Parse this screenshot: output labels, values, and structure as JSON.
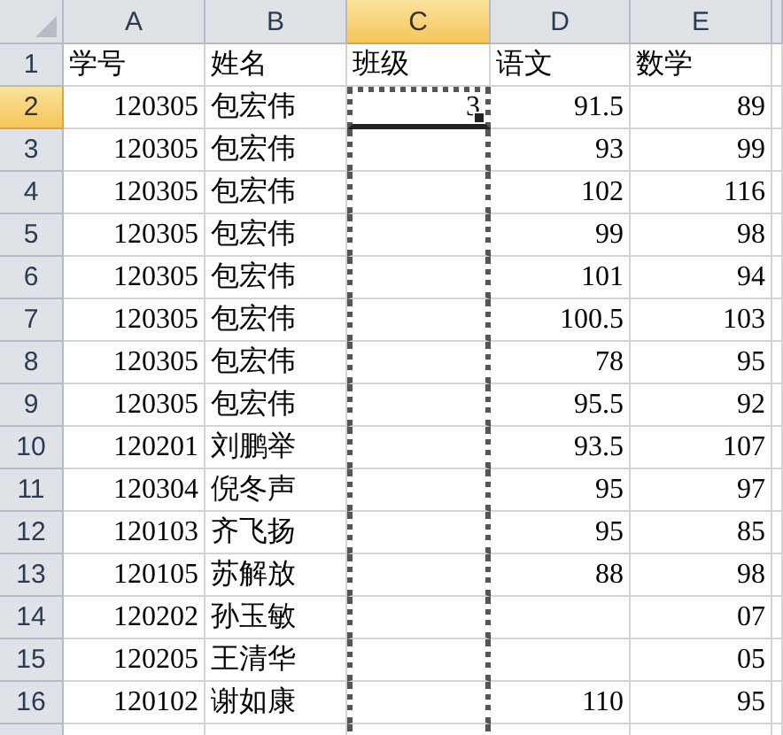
{
  "columns": [
    {
      "label": "A",
      "selected": false,
      "marquee": false
    },
    {
      "label": "B",
      "selected": false,
      "marquee": false
    },
    {
      "label": "C",
      "selected": true,
      "marquee": true
    },
    {
      "label": "D",
      "selected": false,
      "marquee": false
    },
    {
      "label": "E",
      "selected": false,
      "marquee": false
    }
  ],
  "rows": [
    {
      "number": "1",
      "selected": false,
      "kind": "header",
      "cells": [
        "学号",
        "姓名",
        "班级",
        "语文",
        "数学"
      ]
    },
    {
      "number": "2",
      "selected": true,
      "kind": "data",
      "cells": [
        "120305",
        "包宏伟",
        "3",
        "91.5",
        "89"
      ]
    },
    {
      "number": "3",
      "selected": false,
      "kind": "data",
      "cells": [
        "120305",
        "包宏伟",
        null,
        "93",
        "99"
      ]
    },
    {
      "number": "4",
      "selected": false,
      "kind": "data",
      "cells": [
        "120305",
        "包宏伟",
        null,
        "102",
        "116"
      ]
    },
    {
      "number": "5",
      "selected": false,
      "kind": "data",
      "cells": [
        "120305",
        "包宏伟",
        null,
        "99",
        "98"
      ]
    },
    {
      "number": "6",
      "selected": false,
      "kind": "data",
      "cells": [
        "120305",
        "包宏伟",
        null,
        "101",
        "94"
      ]
    },
    {
      "number": "7",
      "selected": false,
      "kind": "data",
      "cells": [
        "120305",
        "包宏伟",
        null,
        "100.5",
        "103"
      ]
    },
    {
      "number": "8",
      "selected": false,
      "kind": "data",
      "cells": [
        "120305",
        "包宏伟",
        null,
        "78",
        "95"
      ]
    },
    {
      "number": "9",
      "selected": false,
      "kind": "data",
      "cells": [
        "120305",
        "包宏伟",
        null,
        "95.5",
        "92"
      ]
    },
    {
      "number": "10",
      "selected": false,
      "kind": "data",
      "cells": [
        "120201",
        "刘鹏举",
        null,
        "93.5",
        "107"
      ]
    },
    {
      "number": "11",
      "selected": false,
      "kind": "data",
      "cells": [
        "120304",
        "倪冬声",
        null,
        "95",
        "97"
      ]
    },
    {
      "number": "12",
      "selected": false,
      "kind": "data",
      "cells": [
        "120103",
        "齐飞扬",
        null,
        "95",
        "85"
      ]
    },
    {
      "number": "13",
      "selected": false,
      "kind": "data",
      "cells": [
        "120105",
        "苏解放",
        null,
        "88",
        "98"
      ]
    },
    {
      "number": "14",
      "selected": false,
      "kind": "data",
      "cells": [
        "120202",
        "孙玉敏",
        null,
        null,
        "07"
      ]
    },
    {
      "number": "15",
      "selected": false,
      "kind": "data",
      "cells": [
        "120205",
        "王清华",
        null,
        null,
        "05"
      ]
    },
    {
      "number": "16",
      "selected": false,
      "kind": "data",
      "cells": [
        "120102",
        "谢如康",
        null,
        "110",
        "95"
      ]
    }
  ]
}
